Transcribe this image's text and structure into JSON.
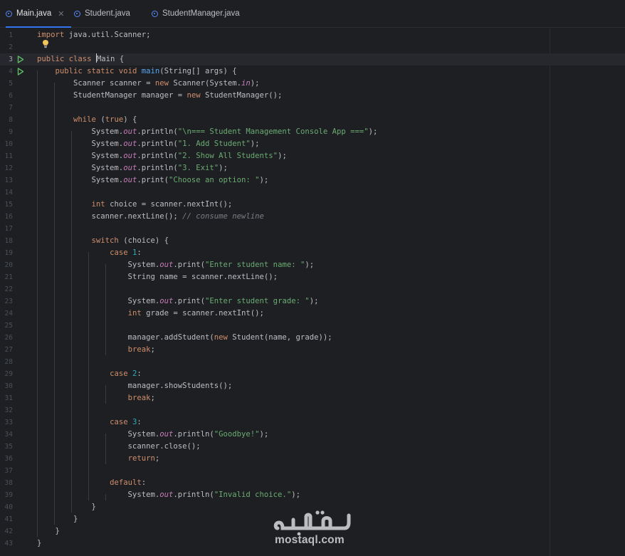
{
  "tabs": [
    {
      "label": "Main.java",
      "active": true,
      "icon": "java-class-icon",
      "closable": true
    },
    {
      "label": "Student.java",
      "active": false,
      "icon": "java-class-icon",
      "closable": false
    },
    {
      "label": "StudentManager.java",
      "active": false,
      "icon": "java-class-icon",
      "closable": false
    }
  ],
  "editor": {
    "current_line": 3,
    "run_gutter_lines": [
      3,
      4
    ],
    "lines": [
      {
        "n": "1",
        "tokens": [
          [
            "kw",
            "import"
          ],
          [
            "p",
            " java.util.Scanner;"
          ]
        ]
      },
      {
        "n": "2",
        "tokens": []
      },
      {
        "n": "3",
        "tokens": [
          [
            "kw",
            "public class "
          ],
          [
            "p",
            "Main {"
          ]
        ]
      },
      {
        "n": "4",
        "tokens": [
          [
            "p",
            "    "
          ],
          [
            "kw",
            "public static void "
          ],
          [
            "fn",
            "main"
          ],
          [
            "p",
            "(String[] args) {"
          ]
        ]
      },
      {
        "n": "5",
        "tokens": [
          [
            "p",
            "        Scanner scanner = "
          ],
          [
            "kw",
            "new "
          ],
          [
            "p",
            "Scanner(System."
          ],
          [
            "st",
            "in"
          ],
          [
            "p",
            ");"
          ]
        ]
      },
      {
        "n": "6",
        "tokens": [
          [
            "p",
            "        StudentManager manager = "
          ],
          [
            "kw",
            "new "
          ],
          [
            "p",
            "StudentManager();"
          ]
        ]
      },
      {
        "n": "7",
        "tokens": []
      },
      {
        "n": "8",
        "tokens": [
          [
            "p",
            "        "
          ],
          [
            "kw",
            "while "
          ],
          [
            "p",
            "("
          ],
          [
            "kw",
            "true"
          ],
          [
            "p",
            ") {"
          ]
        ]
      },
      {
        "n": "9",
        "tokens": [
          [
            "p",
            "            System."
          ],
          [
            "st",
            "out"
          ],
          [
            "p",
            ".println("
          ],
          [
            "str",
            "\"\\n=== Student Management Console App ===\""
          ],
          [
            "p",
            ");"
          ]
        ]
      },
      {
        "n": "10",
        "tokens": [
          [
            "p",
            "            System."
          ],
          [
            "st",
            "out"
          ],
          [
            "p",
            ".println("
          ],
          [
            "str",
            "\"1. Add Student\""
          ],
          [
            "p",
            ");"
          ]
        ]
      },
      {
        "n": "11",
        "tokens": [
          [
            "p",
            "            System."
          ],
          [
            "st",
            "out"
          ],
          [
            "p",
            ".println("
          ],
          [
            "str",
            "\"2. Show All Students\""
          ],
          [
            "p",
            ");"
          ]
        ]
      },
      {
        "n": "12",
        "tokens": [
          [
            "p",
            "            System."
          ],
          [
            "st",
            "out"
          ],
          [
            "p",
            ".println("
          ],
          [
            "str",
            "\"3. Exit\""
          ],
          [
            "p",
            ");"
          ]
        ]
      },
      {
        "n": "13",
        "tokens": [
          [
            "p",
            "            System."
          ],
          [
            "st",
            "out"
          ],
          [
            "p",
            ".print("
          ],
          [
            "str",
            "\"Choose an option: \""
          ],
          [
            "p",
            ");"
          ]
        ]
      },
      {
        "n": "14",
        "tokens": []
      },
      {
        "n": "15",
        "tokens": [
          [
            "p",
            "            "
          ],
          [
            "kw",
            "int "
          ],
          [
            "p",
            "choice = scanner.nextInt();"
          ]
        ]
      },
      {
        "n": "16",
        "tokens": [
          [
            "p",
            "            scanner.nextLine(); "
          ],
          [
            "cm",
            "// consume newline"
          ]
        ]
      },
      {
        "n": "17",
        "tokens": []
      },
      {
        "n": "18",
        "tokens": [
          [
            "p",
            "            "
          ],
          [
            "kw",
            "switch "
          ],
          [
            "p",
            "(choice) {"
          ]
        ]
      },
      {
        "n": "19",
        "tokens": [
          [
            "p",
            "                "
          ],
          [
            "kw",
            "case "
          ],
          [
            "num",
            "1"
          ],
          [
            "p",
            ":"
          ]
        ]
      },
      {
        "n": "20",
        "tokens": [
          [
            "p",
            "                    System."
          ],
          [
            "st",
            "out"
          ],
          [
            "p",
            ".print("
          ],
          [
            "str",
            "\"Enter student name: \""
          ],
          [
            "p",
            ");"
          ]
        ]
      },
      {
        "n": "21",
        "tokens": [
          [
            "p",
            "                    String name = scanner.nextLine();"
          ]
        ]
      },
      {
        "n": "22",
        "tokens": []
      },
      {
        "n": "23",
        "tokens": [
          [
            "p",
            "                    System."
          ],
          [
            "st",
            "out"
          ],
          [
            "p",
            ".print("
          ],
          [
            "str",
            "\"Enter student grade: \""
          ],
          [
            "p",
            ");"
          ]
        ]
      },
      {
        "n": "24",
        "tokens": [
          [
            "p",
            "                    "
          ],
          [
            "kw",
            "int "
          ],
          [
            "p",
            "grade = scanner.nextInt();"
          ]
        ]
      },
      {
        "n": "25",
        "tokens": []
      },
      {
        "n": "26",
        "tokens": [
          [
            "p",
            "                    manager.addStudent("
          ],
          [
            "kw",
            "new "
          ],
          [
            "p",
            "Student(name, grade));"
          ]
        ]
      },
      {
        "n": "27",
        "tokens": [
          [
            "p",
            "                    "
          ],
          [
            "kw",
            "break"
          ],
          [
            "p",
            ";"
          ]
        ]
      },
      {
        "n": "28",
        "tokens": []
      },
      {
        "n": "29",
        "tokens": [
          [
            "p",
            "                "
          ],
          [
            "kw",
            "case "
          ],
          [
            "num",
            "2"
          ],
          [
            "p",
            ":"
          ]
        ]
      },
      {
        "n": "30",
        "tokens": [
          [
            "p",
            "                    manager.showStudents();"
          ]
        ]
      },
      {
        "n": "31",
        "tokens": [
          [
            "p",
            "                    "
          ],
          [
            "kw",
            "break"
          ],
          [
            "p",
            ";"
          ]
        ]
      },
      {
        "n": "32",
        "tokens": []
      },
      {
        "n": "33",
        "tokens": [
          [
            "p",
            "                "
          ],
          [
            "kw",
            "case "
          ],
          [
            "num",
            "3"
          ],
          [
            "p",
            ":"
          ]
        ]
      },
      {
        "n": "34",
        "tokens": [
          [
            "p",
            "                    System."
          ],
          [
            "st",
            "out"
          ],
          [
            "p",
            ".println("
          ],
          [
            "str",
            "\"Goodbye!\""
          ],
          [
            "p",
            ");"
          ]
        ]
      },
      {
        "n": "35",
        "tokens": [
          [
            "p",
            "                    scanner.close();"
          ]
        ]
      },
      {
        "n": "36",
        "tokens": [
          [
            "p",
            "                    "
          ],
          [
            "kw",
            "return"
          ],
          [
            "p",
            ";"
          ]
        ]
      },
      {
        "n": "37",
        "tokens": []
      },
      {
        "n": "38",
        "tokens": [
          [
            "p",
            "                "
          ],
          [
            "kw",
            "default"
          ],
          [
            "p",
            ":"
          ]
        ]
      },
      {
        "n": "39",
        "tokens": [
          [
            "p",
            "                    System."
          ],
          [
            "st",
            "out"
          ],
          [
            "p",
            ".println("
          ],
          [
            "str",
            "\"Invalid choice.\""
          ],
          [
            "p",
            ");"
          ]
        ]
      },
      {
        "n": "40",
        "tokens": [
          [
            "p",
            "            }"
          ]
        ]
      },
      {
        "n": "41",
        "tokens": [
          [
            "p",
            "        }"
          ]
        ]
      },
      {
        "n": "42",
        "tokens": [
          [
            "p",
            "    }"
          ]
        ]
      },
      {
        "n": "43",
        "tokens": [
          [
            "p",
            "}"
          ]
        ]
      }
    ]
  },
  "watermark": {
    "arabic": "مستقل",
    "latin": "mostaql.com"
  },
  "colors": {
    "background": "#1e1f22",
    "keyword": "#cf8e6d",
    "string": "#6aab73",
    "number": "#2aacb8",
    "function": "#56a8f5",
    "static_field": "#c77dbb",
    "comment": "#7a7e85",
    "accent": "#3574f0",
    "run_icon": "#5fb865"
  }
}
